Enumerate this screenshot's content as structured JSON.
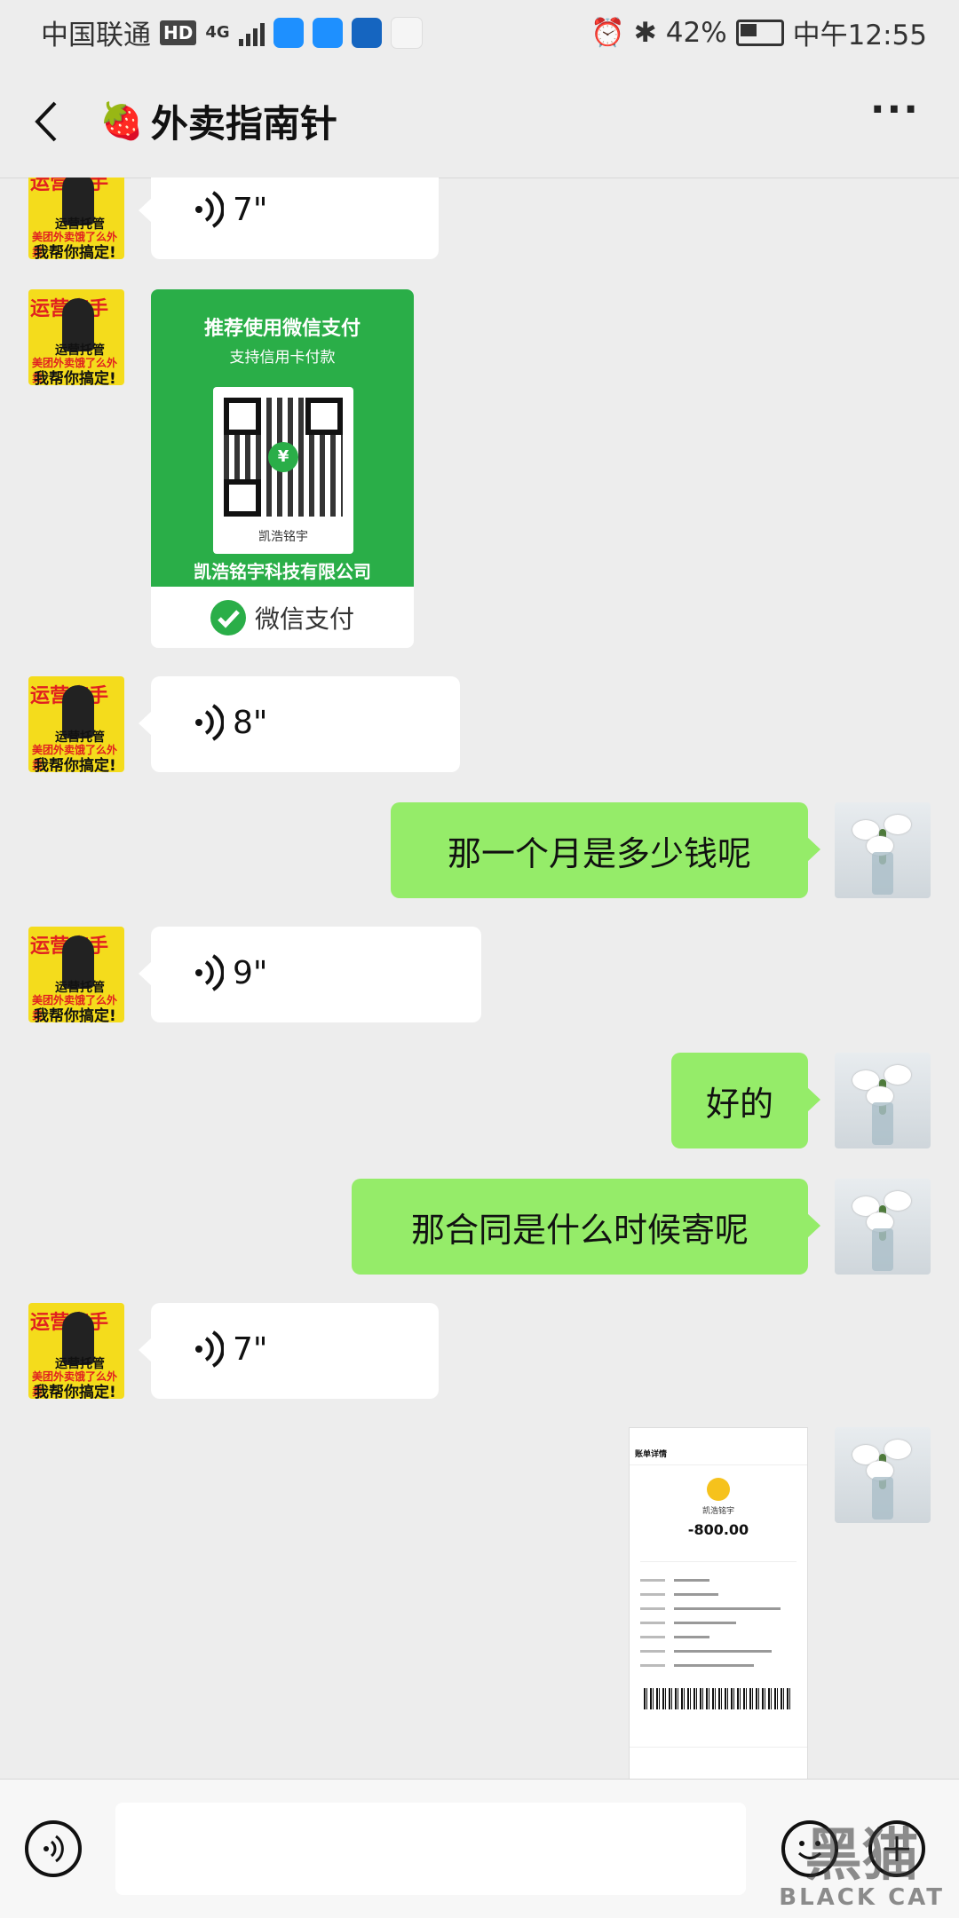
{
  "status_bar": {
    "carrier": "中国联通",
    "hd": "HD",
    "network": "4G",
    "battery": "42%",
    "time": "中午12:55"
  },
  "nav": {
    "back_icon": "chevron-left-icon",
    "title_emoji": "🍓",
    "title": "外卖指南针",
    "more": "···"
  },
  "avatar_left": {
    "line1": "运营高手",
    "line2": "运营托管",
    "line3": "美团外卖饿了么外卖",
    "line4": "我帮你搞定!"
  },
  "messages": [
    {
      "side": "left",
      "type": "voice",
      "duration": "7\""
    },
    {
      "side": "left",
      "type": "pay_card"
    },
    {
      "side": "left",
      "type": "voice",
      "duration": "8\""
    },
    {
      "side": "right",
      "type": "text",
      "text": "那一个月是多少钱呢"
    },
    {
      "side": "left",
      "type": "voice",
      "duration": "9\""
    },
    {
      "side": "right",
      "type": "text",
      "text": "好的"
    },
    {
      "side": "right",
      "type": "text",
      "text": "那合同是什么时候寄呢"
    },
    {
      "side": "left",
      "type": "voice",
      "duration": "7\""
    },
    {
      "side": "right",
      "type": "image"
    }
  ],
  "pay_card": {
    "title": "推荐使用微信支付",
    "subtitle": "支持信用卡付款",
    "qr_name": "凯浩铭宇",
    "company": "凯浩铭宇科技有限公司",
    "footer": "微信支付",
    "yen": "¥"
  },
  "receipt": {
    "header": "账单详情",
    "merchant": "凯浩铭宇",
    "amount": "-800.00"
  },
  "watermark": {
    "big": "黑猫",
    "small": "BLACK CAT"
  },
  "colors": {
    "bg": "#ededed",
    "green_bubble": "#95ec69",
    "pay_green": "#2aae48"
  }
}
